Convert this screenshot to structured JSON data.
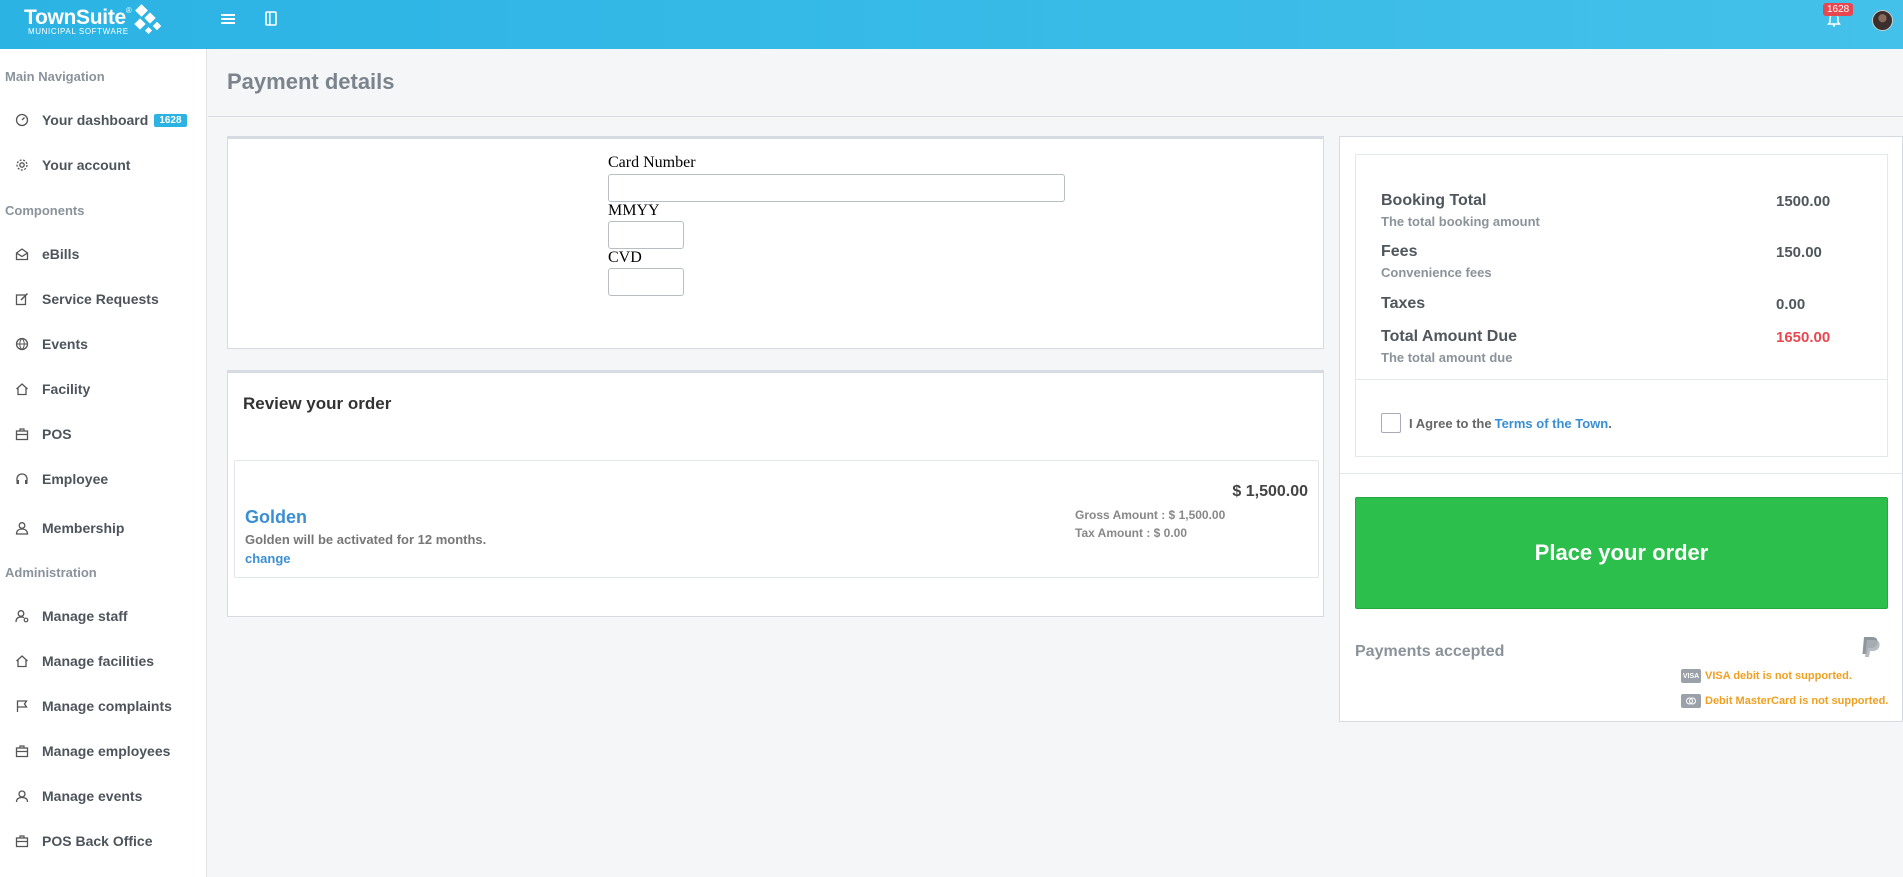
{
  "header": {
    "logo_name": "TownSuite",
    "logo_reg": "®",
    "logo_sub": "MUNICIPAL SOFTWARE",
    "notification_count": "1628"
  },
  "sidebar": {
    "sections": [
      {
        "title": "Main Navigation",
        "items": [
          {
            "label": "Your dashboard",
            "icon": "dashboard-icon",
            "badge": "1628"
          },
          {
            "label": "Your account",
            "icon": "gear-icon"
          }
        ]
      },
      {
        "title": "Components",
        "items": [
          {
            "label": "eBills",
            "icon": "envelope-open-icon"
          },
          {
            "label": "Service Requests",
            "icon": "edit-icon"
          },
          {
            "label": "Events",
            "icon": "basketball-icon"
          },
          {
            "label": "Facility",
            "icon": "home-icon"
          },
          {
            "label": "POS",
            "icon": "briefcase-icon"
          },
          {
            "label": "Employee",
            "icon": "headset-icon"
          },
          {
            "label": "Membership",
            "icon": "user-icon"
          }
        ]
      },
      {
        "title": "Administration",
        "items": [
          {
            "label": "Manage staff",
            "icon": "user-gear-icon"
          },
          {
            "label": "Manage facilities",
            "icon": "home-icon"
          },
          {
            "label": "Manage complaints",
            "icon": "flag-icon"
          },
          {
            "label": "Manage employees",
            "icon": "briefcase-icon"
          },
          {
            "label": "Manage events",
            "icon": "user-group-icon"
          },
          {
            "label": "POS Back Office",
            "icon": "briefcase-icon"
          }
        ]
      }
    ]
  },
  "page": {
    "title": "Payment details"
  },
  "payment_form": {
    "card_number_label": "Card Number",
    "card_number_value": "",
    "mmyy_label": "MMYY",
    "mmyy_value": "",
    "cvd_label": "CVD",
    "cvd_value": ""
  },
  "review": {
    "title": "Review your order",
    "item": {
      "name": "Golden",
      "description": "Golden will be activated for 12 months.",
      "change_label": "change",
      "price": "$ 1,500.00",
      "gross": "Gross Amount : $ 1,500.00",
      "tax": "Tax Amount : $ 0.00"
    }
  },
  "summary": {
    "booking_total_label": "Booking Total",
    "booking_total_sub": "The total booking amount",
    "booking_total_value": "1500.00",
    "fees_label": "Fees",
    "fees_sub": "Convenience fees",
    "fees_value": "150.00",
    "taxes_label": "Taxes",
    "taxes_value": "0.00",
    "total_due_label": "Total Amount Due",
    "total_due_sub": "The total amount due",
    "total_due_value": "1650.00",
    "agree_text": "I Agree to the",
    "agree_link": "Terms of the Town",
    "agree_period": ".",
    "place_order_label": "Place your order",
    "payments_accepted_label": "Payments accepted",
    "visa_warning": "VISA debit is not supported.",
    "visa_card_text": "VISA",
    "mc_warning": "Debit MasterCard is not supported.",
    "colors": {
      "accent": "#2bb3e4",
      "order_button": "#2cbf4c",
      "total_due": "#e8474f",
      "warning": "#f0a020",
      "link": "#3a8fd4"
    }
  }
}
